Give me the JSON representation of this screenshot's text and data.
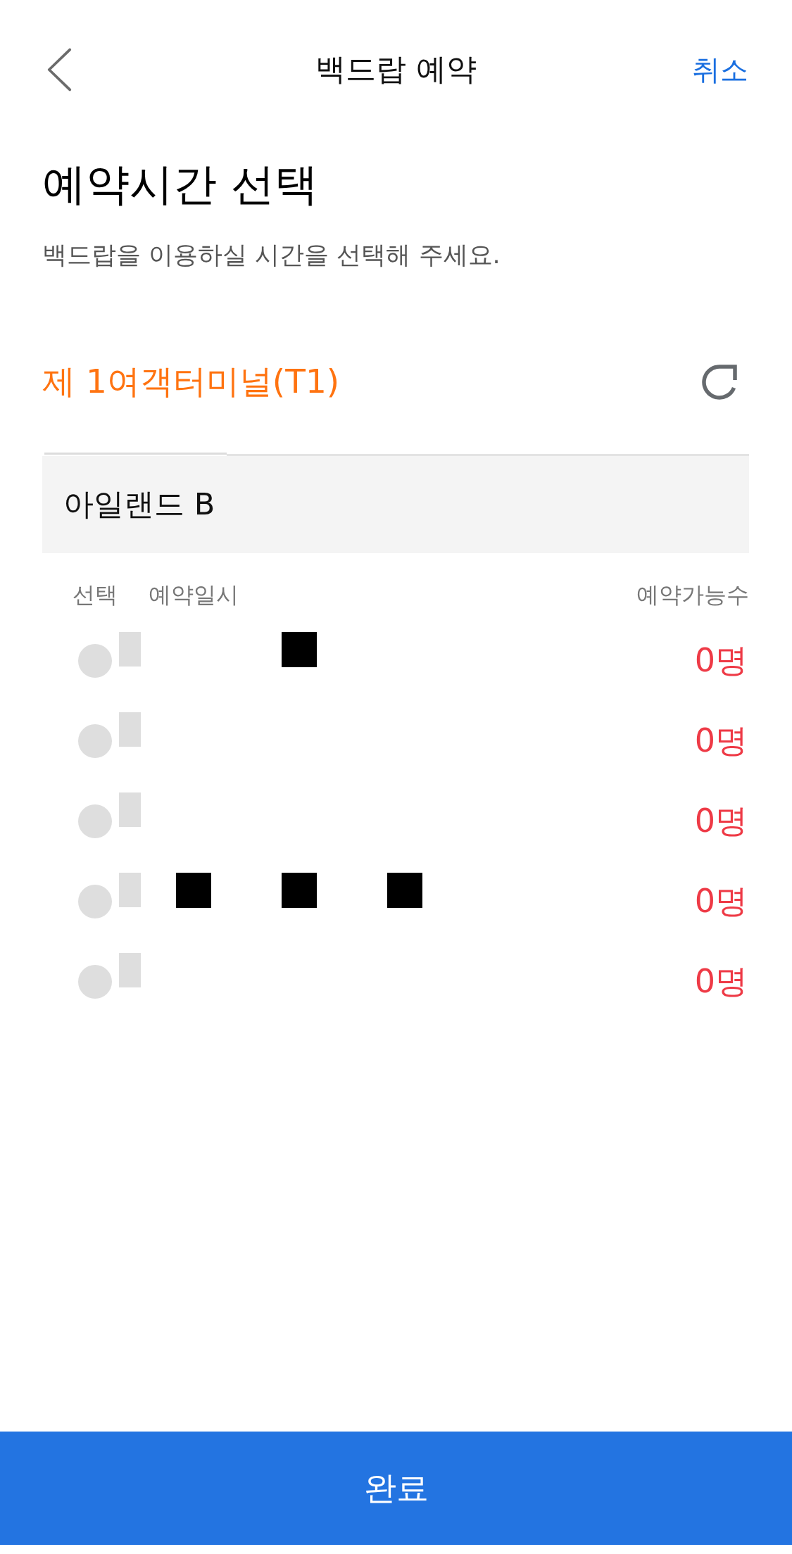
{
  "header": {
    "title": "백드랍 예약",
    "cancel": "취소"
  },
  "heading": "예약시간 선택",
  "instruction": "백드랍을 이용하실 시간을 선택해 주세요.",
  "terminal": {
    "name": "제 1여객터미널(T1)"
  },
  "zone": "아일랜드 B",
  "table": {
    "columns": [
      "선택",
      "예약일시",
      "예약가능수"
    ],
    "rows": [
      {
        "selected": false,
        "date_marks": [
          {
            "kind": "placeholder"
          },
          {
            "kind": "blank"
          },
          {
            "kind": "redacted"
          }
        ],
        "available": "0명"
      },
      {
        "selected": false,
        "date_marks": [
          {
            "kind": "placeholder"
          }
        ],
        "available": "0명"
      },
      {
        "selected": false,
        "date_marks": [
          {
            "kind": "placeholder"
          }
        ],
        "available": "0명"
      },
      {
        "selected": false,
        "date_marks": [
          {
            "kind": "placeholder"
          },
          {
            "kind": "redacted"
          },
          {
            "kind": "redacted"
          },
          {
            "kind": "redacted"
          }
        ],
        "available": "0명"
      },
      {
        "selected": false,
        "date_marks": [
          {
            "kind": "placeholder"
          }
        ],
        "available": "0명"
      }
    ]
  },
  "done_button": "완료"
}
